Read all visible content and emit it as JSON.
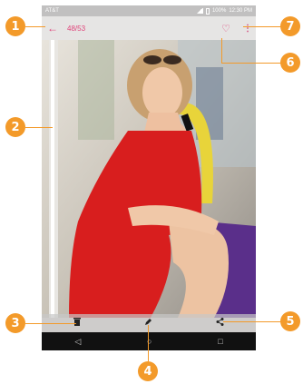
{
  "status_bar": {
    "carrier": "AT&T",
    "battery": "100%",
    "time": "12:30 PM"
  },
  "toolbar": {
    "back_icon": "arrow-left-icon",
    "counter": "48/53",
    "favorite_icon": "heart-outline-icon",
    "more_icon": "more-vert-icon"
  },
  "bottom_bar": {
    "delete_icon": "trash-icon",
    "edit_icon": "pencil-icon",
    "share_icon": "share-icon"
  },
  "nav_bar": {
    "back": "◁",
    "home": "○",
    "recents": "□"
  },
  "callouts": [
    "1",
    "2",
    "3",
    "4",
    "5",
    "6",
    "7"
  ],
  "colors": {
    "accent": "#e0457b",
    "callout": "#f39a2a",
    "dress": "#d81e1e"
  }
}
